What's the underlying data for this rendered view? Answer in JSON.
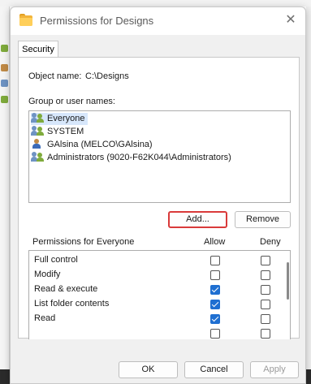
{
  "window": {
    "title": "Permissions for Designs",
    "close_glyph": "✕",
    "title_icon": "folder-icon"
  },
  "tabs": [
    {
      "label": "Security",
      "active": true
    }
  ],
  "security": {
    "object_label": "Object name:",
    "object_value": "C:\\Designs",
    "group_label": "Group or user names:",
    "users": [
      {
        "name": "Everyone",
        "icon": "group-users-icon",
        "selected": true
      },
      {
        "name": "SYSTEM",
        "icon": "group-users-icon",
        "selected": false
      },
      {
        "name": "GAlsina (MELCO\\GAlsina)",
        "icon": "user-icon",
        "selected": false
      },
      {
        "name": "Administrators (9020-F62K044\\Administrators)",
        "icon": "group-users-icon",
        "selected": false
      }
    ],
    "add_label": "Add...",
    "remove_label": "Remove",
    "permissions_header": "Permissions for Everyone",
    "allow_header": "Allow",
    "deny_header": "Deny",
    "permissions": [
      {
        "name": "Full control",
        "allow": false,
        "deny": false
      },
      {
        "name": "Modify",
        "allow": false,
        "deny": false
      },
      {
        "name": "Read & execute",
        "allow": true,
        "deny": false
      },
      {
        "name": "List folder contents",
        "allow": true,
        "deny": false
      },
      {
        "name": "Read",
        "allow": true,
        "deny": false
      },
      {
        "name": "",
        "allow": false,
        "deny": false
      }
    ]
  },
  "footer": {
    "ok_label": "OK",
    "cancel_label": "Cancel",
    "apply_label": "Apply"
  },
  "colors": {
    "highlight_border": "#d93a3a",
    "checkbox_checked": "#1f6fd1",
    "selected_row": "#d7e7fb"
  }
}
